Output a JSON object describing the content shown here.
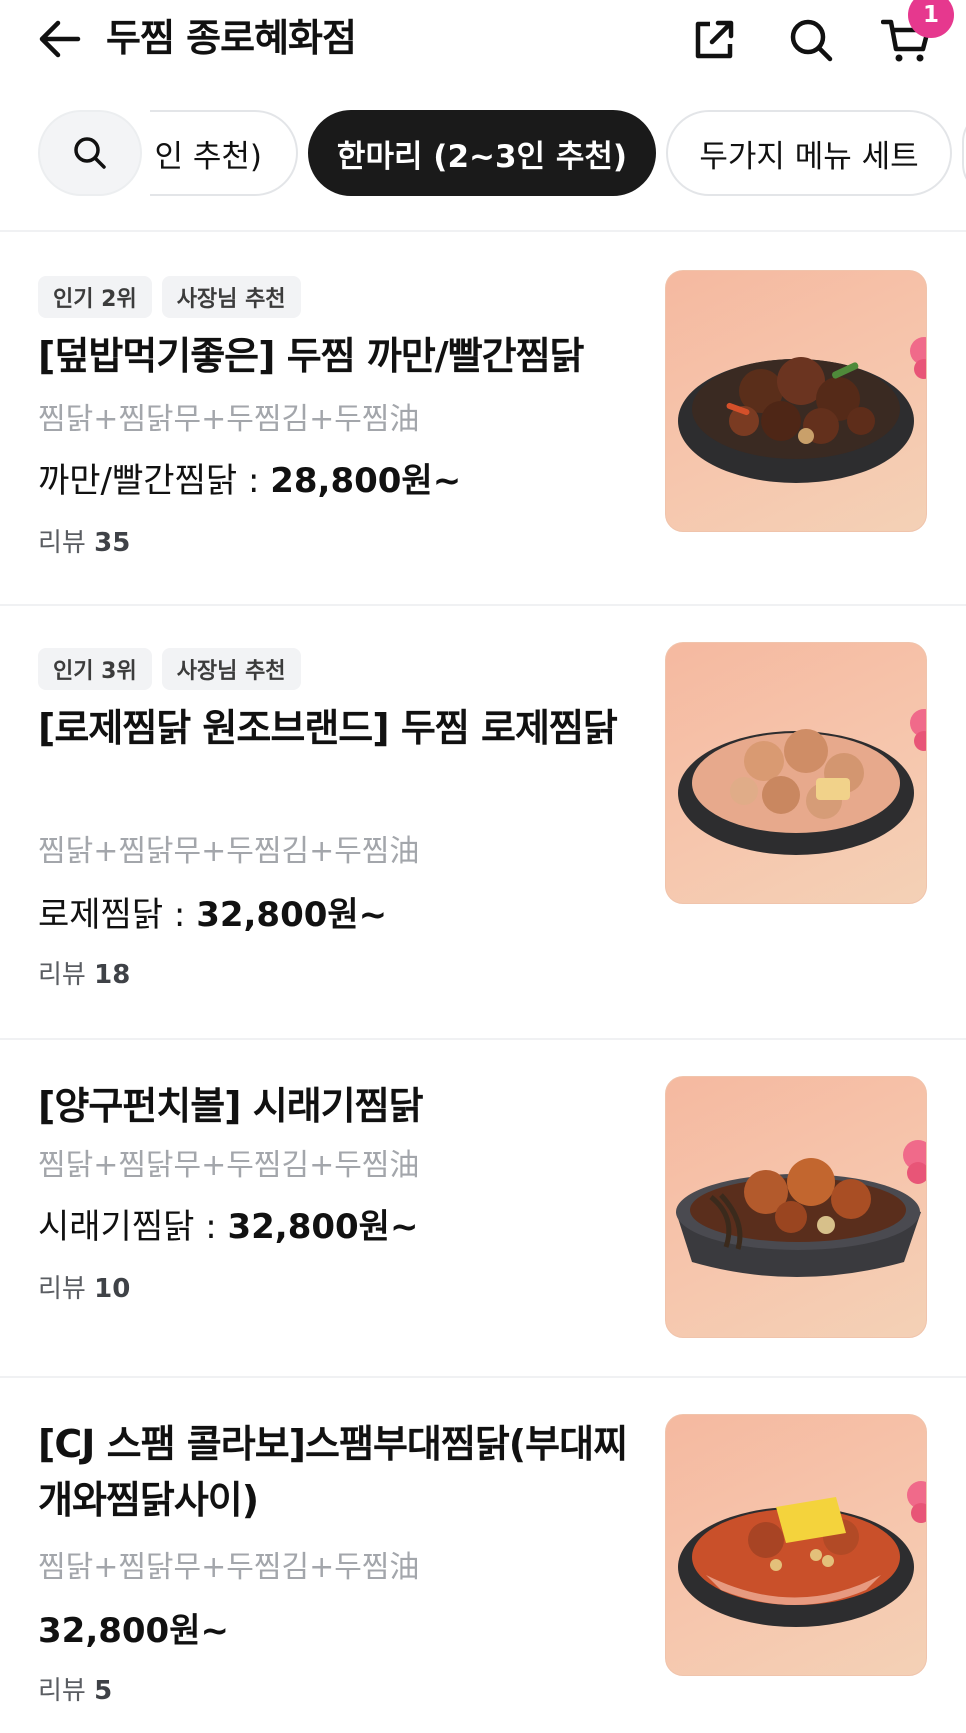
{
  "header": {
    "title": "두찜 종로혜화점",
    "cart_count": "1"
  },
  "chips": {
    "partial_left_label": "인 추천)",
    "active_label": "한마리 (2~3인 추천)",
    "third_label": "두가지 메뉴 세트"
  },
  "items": [
    {
      "tags": [
        "인기 2위",
        "사장님 추천"
      ],
      "name": "[덮밥먹기좋은] 두찜 까만/빨간찜닭",
      "desc": "찜닭+찜닭무+두찜김+두찜油",
      "price_option": "까만/빨간찜닭 : ",
      "price_value": "28,800원~",
      "review_label": "리뷰",
      "review_count": "35",
      "dish": "dark-braised-chicken"
    },
    {
      "tags": [
        "인기 3위",
        "사장님 추천"
      ],
      "name": "[로제찜닭 원조브랜드] 두찜 로제찜닭",
      "desc": "찜닭+찜닭무+두찜김+두찜油",
      "price_option": "로제찜닭 : ",
      "price_value": "32,800원~",
      "review_label": "리뷰",
      "review_count": "18",
      "dish": "rose-braised-chicken"
    },
    {
      "tags": [],
      "name": "[양구펀치볼] 시래기찜닭",
      "desc": "찜닭+찜닭무+두찜김+두찜油",
      "price_option": "시래기찜닭 : ",
      "price_value": "32,800원~",
      "review_label": "리뷰",
      "review_count": "10",
      "dish": "siraegi-braised-chicken"
    },
    {
      "tags": [],
      "name": "[CJ 스팸 콜라보]스팸부대찜닭(부대찌개와찜닭사이)",
      "desc": "찜닭+찜닭무+두찜김+두찜油",
      "price_option": "",
      "price_value": "32,800원~",
      "review_label": "리뷰",
      "review_count": "5",
      "dish": "spam-budae-braised-chicken"
    }
  ],
  "icons": {
    "back": "arrow-left-icon",
    "share": "share-icon",
    "search": "search-icon",
    "cart": "cart-icon"
  },
  "colors": {
    "badge": "#e6388e",
    "active_chip": "#1a1a1a",
    "thumb_bg": "#f5bfa6"
  }
}
